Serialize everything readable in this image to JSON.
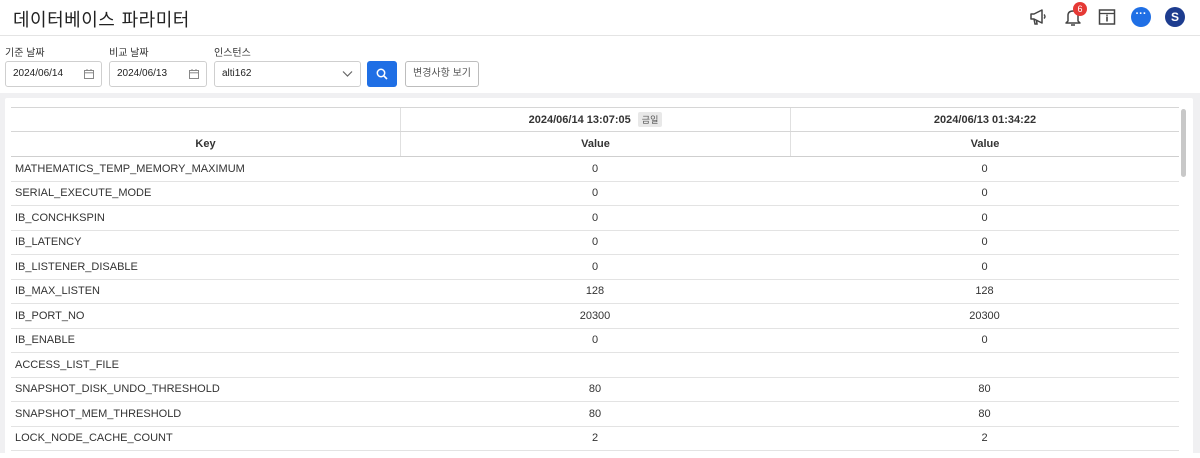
{
  "header": {
    "title": "데이터베이스 파라미터",
    "notification_count": "6",
    "chat_icon_text": "···",
    "avatar_letter": "S"
  },
  "filters": {
    "base_date_label": "기준 날짜",
    "base_date_value": "2024/06/14",
    "compare_date_label": "비교 날짜",
    "compare_date_value": "2024/06/13",
    "instance_label": "인스턴스",
    "instance_value": "alti162",
    "view_changes_label": "변경사항 보기"
  },
  "table": {
    "key_header": "Key",
    "col1_timestamp": "2024/06/14 13:07:05",
    "col1_tag": "금일",
    "col2_timestamp": "2024/06/13 01:34:22",
    "value_header": "Value",
    "rows": [
      {
        "key": "MATHEMATICS_TEMP_MEMORY_MAXIMUM",
        "v1": "0",
        "v2": "0"
      },
      {
        "key": "SERIAL_EXECUTE_MODE",
        "v1": "0",
        "v2": "0"
      },
      {
        "key": "IB_CONCHKSPIN",
        "v1": "0",
        "v2": "0"
      },
      {
        "key": "IB_LATENCY",
        "v1": "0",
        "v2": "0"
      },
      {
        "key": "IB_LISTENER_DISABLE",
        "v1": "0",
        "v2": "0"
      },
      {
        "key": "IB_MAX_LISTEN",
        "v1": "128",
        "v2": "128"
      },
      {
        "key": "IB_PORT_NO",
        "v1": "20300",
        "v2": "20300"
      },
      {
        "key": "IB_ENABLE",
        "v1": "0",
        "v2": "0"
      },
      {
        "key": "ACCESS_LIST_FILE",
        "v1": "",
        "v2": ""
      },
      {
        "key": "SNAPSHOT_DISK_UNDO_THRESHOLD",
        "v1": "80",
        "v2": "80"
      },
      {
        "key": "SNAPSHOT_MEM_THRESHOLD",
        "v1": "80",
        "v2": "80"
      },
      {
        "key": "LOCK_NODE_CACHE_COUNT",
        "v1": "2",
        "v2": "2"
      }
    ]
  },
  "colors": {
    "accent": "#1f6fe5",
    "badge": "#e53935",
    "avatar": "#1d3c8f"
  }
}
